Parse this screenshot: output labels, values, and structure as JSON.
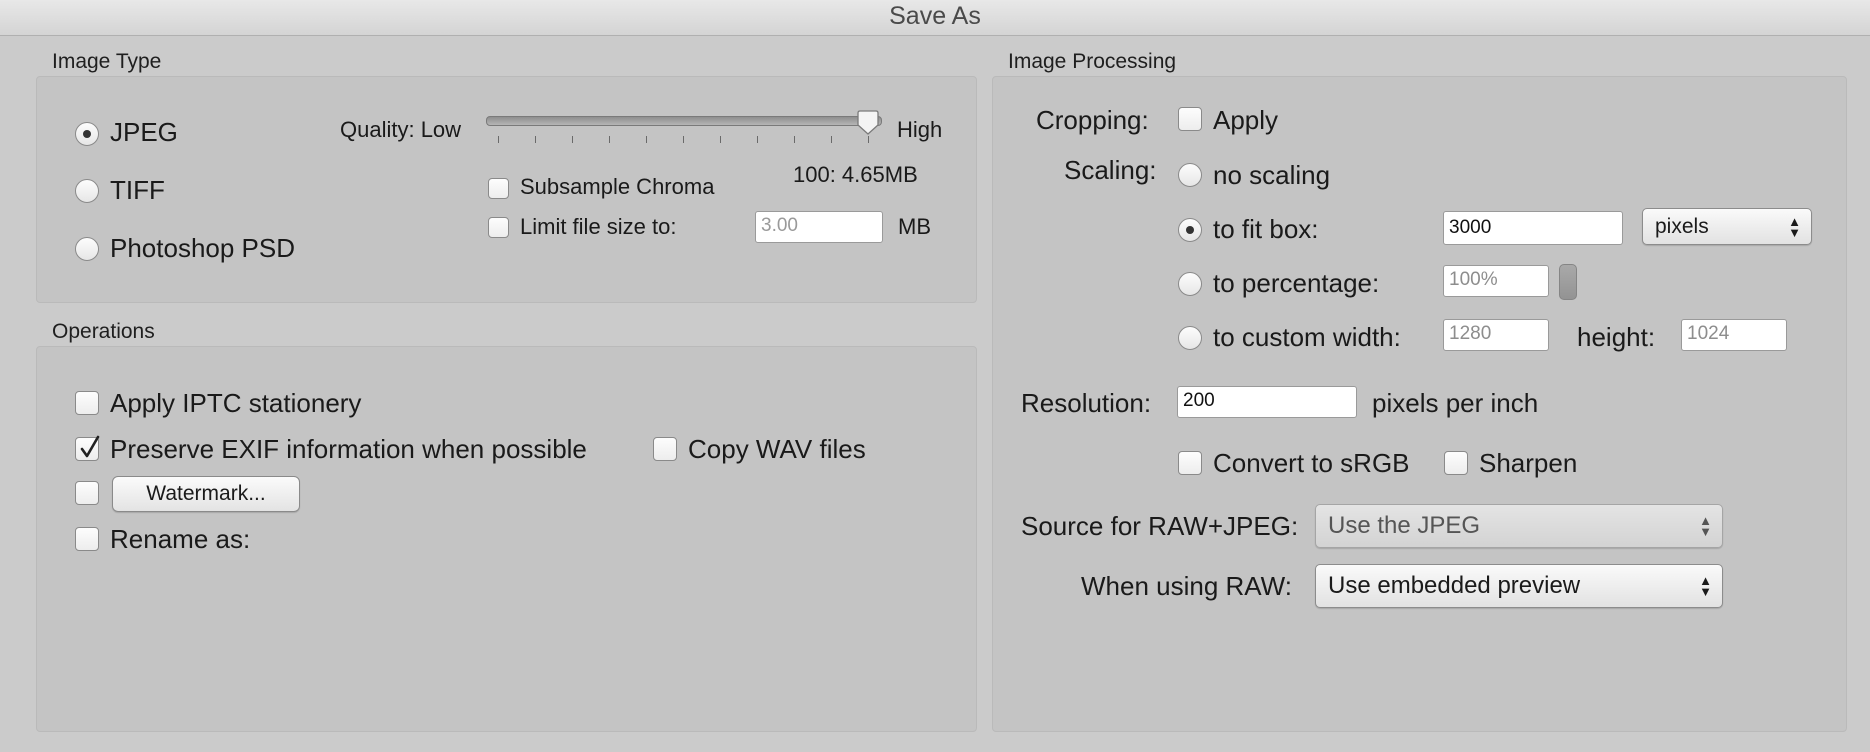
{
  "window": {
    "title": "Save As"
  },
  "image_type": {
    "section_label": "Image Type",
    "formats": [
      {
        "label": "JPEG",
        "selected": true
      },
      {
        "label": "TIFF",
        "selected": false
      },
      {
        "label": "Photoshop PSD",
        "selected": false
      }
    ],
    "quality": {
      "label_low": "Quality: Low",
      "label_high": "High",
      "value": 100,
      "max": 100,
      "readout": "100: 4.65MB"
    },
    "subsample_chroma": {
      "label": "Subsample Chroma",
      "checked": false
    },
    "limit_file_size": {
      "label": "Limit file size to:",
      "checked": false,
      "value": "3.00",
      "unit": "MB"
    }
  },
  "operations": {
    "section_label": "Operations",
    "apply_iptc": {
      "label": "Apply IPTC stationery",
      "checked": false
    },
    "preserve_exif": {
      "label": "Preserve EXIF information when possible",
      "checked": true
    },
    "copy_wav": {
      "label": "Copy WAV files",
      "checked": false
    },
    "watermark": {
      "checked": false,
      "button_label": "Watermark..."
    },
    "rename_as": {
      "label": "Rename as:",
      "checked": false
    }
  },
  "image_processing": {
    "section_label": "Image Processing",
    "cropping": {
      "label": "Cropping:",
      "apply_label": "Apply",
      "checked": false
    },
    "scaling": {
      "label": "Scaling:",
      "no_scaling": {
        "label": "no scaling",
        "selected": false
      },
      "fit_box": {
        "label": "to fit box:",
        "selected": true,
        "value": "3000",
        "unit": "pixels"
      },
      "percentage": {
        "label": "to percentage:",
        "selected": false,
        "value": "100%"
      },
      "custom": {
        "label": "to custom width:",
        "selected": false,
        "width": "1280",
        "height_label": "height:",
        "height": "1024"
      }
    },
    "resolution": {
      "label": "Resolution:",
      "value": "200",
      "unit": "pixels per inch"
    },
    "convert_srgb": {
      "label": "Convert to sRGB",
      "checked": false
    },
    "sharpen": {
      "label": "Sharpen",
      "checked": false
    },
    "source_raw_jpeg": {
      "label": "Source for RAW+JPEG:",
      "value": "Use the JPEG"
    },
    "when_using_raw": {
      "label": "When using RAW:",
      "value": "Use embedded preview"
    }
  }
}
